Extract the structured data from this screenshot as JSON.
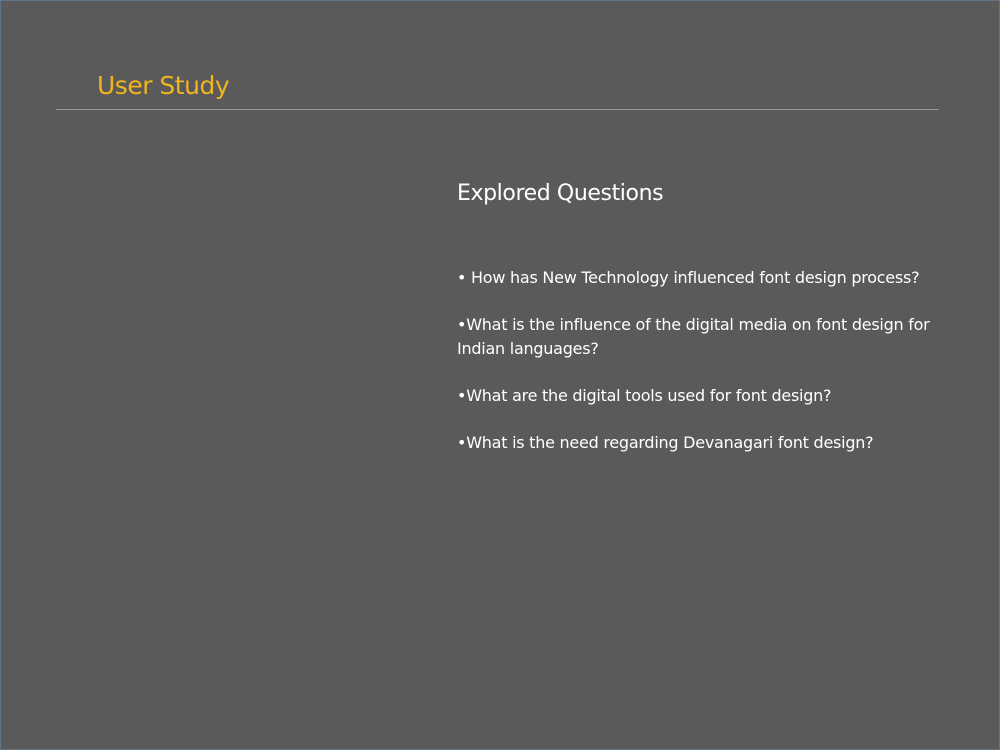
{
  "slide": {
    "title": "User Study",
    "section_heading": "Explored Questions",
    "questions": [
      "• How has New Technology influenced font design process?",
      "•What is the influence of the digital media on font design for Indian languages?",
      "•What are the digital tools used for font design?",
      "•What is the need regarding Devanagari font design?"
    ]
  },
  "colors": {
    "background": "#5a5a5a",
    "title": "#f2b51f",
    "text": "#ffffff",
    "rule": "#9a9a9a",
    "frame": "#5f7389"
  }
}
